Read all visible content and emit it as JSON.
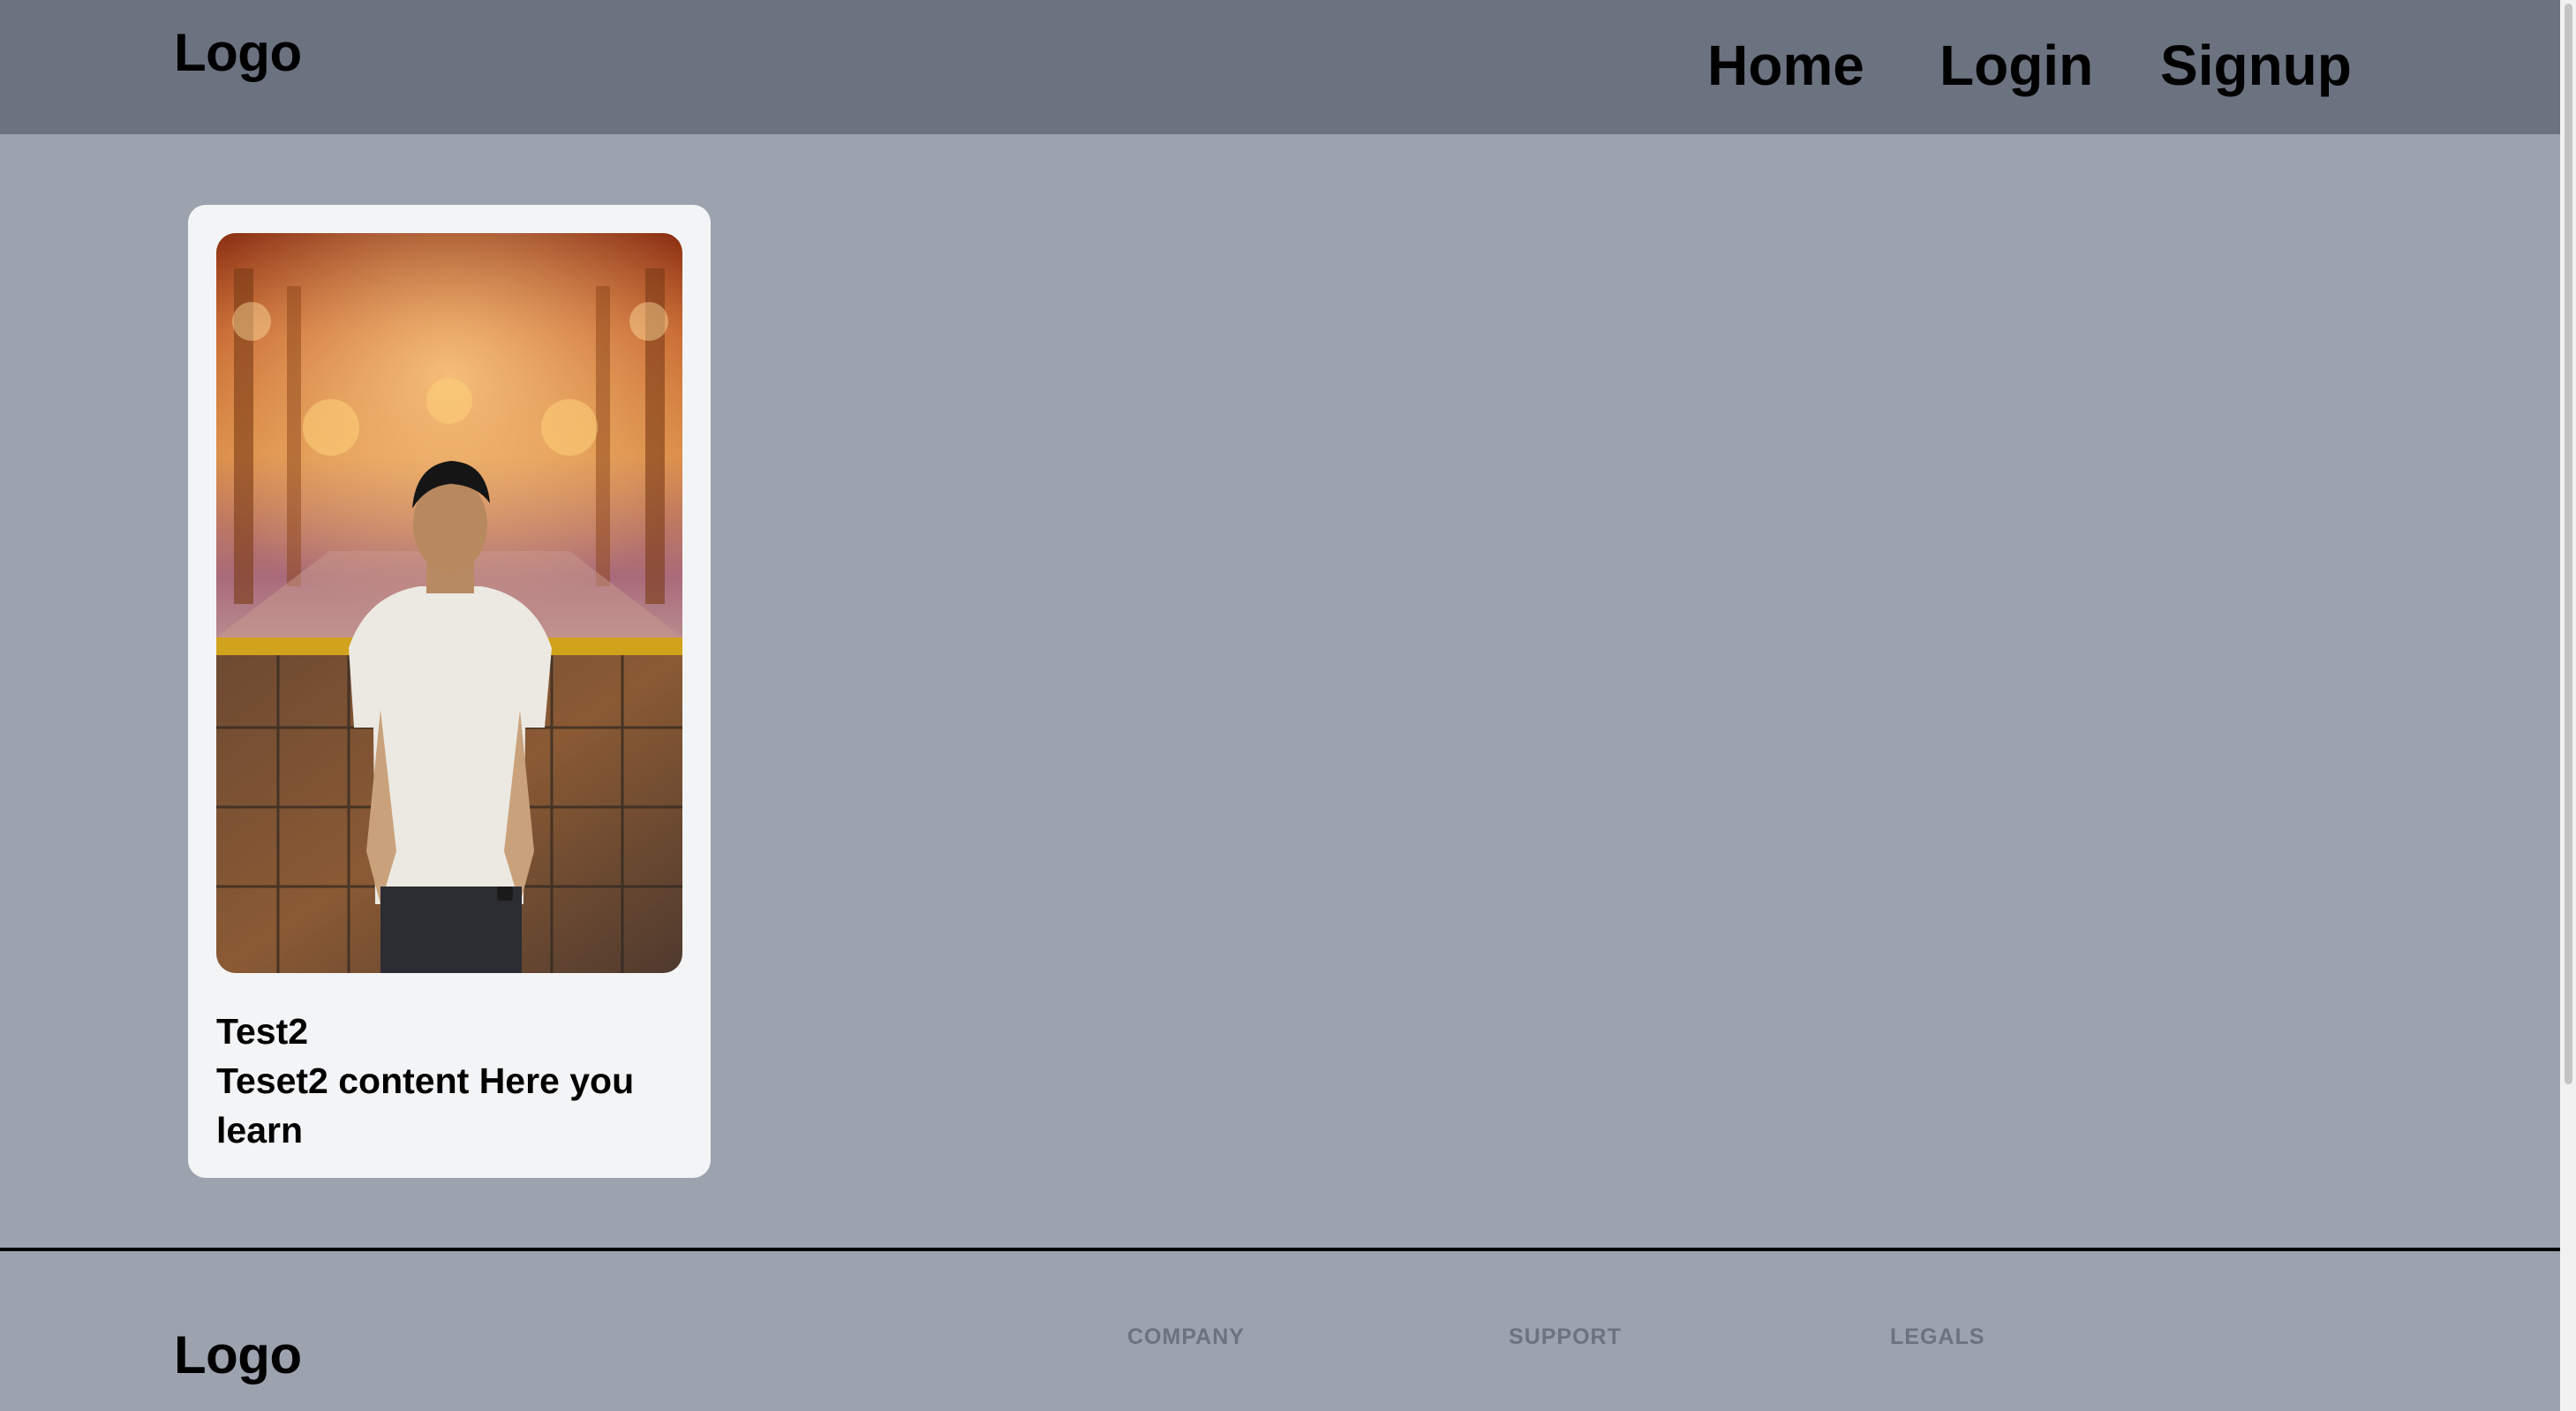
{
  "header": {
    "logo": "Logo",
    "nav": {
      "home": "Home",
      "login": "Login",
      "signup": "Signup"
    }
  },
  "card": {
    "title": "Test2",
    "content": "Teset2 content Here you learn"
  },
  "footer": {
    "logo": "Logo",
    "columns": {
      "company": "COMPANY",
      "support": "SUPPORT",
      "legals": "LEGALS"
    }
  },
  "colors": {
    "header_bg": "#6b7280",
    "page_bg": "#9ca3af",
    "card_bg": "#f3f4f6",
    "footer_heading": "#6b7280"
  }
}
